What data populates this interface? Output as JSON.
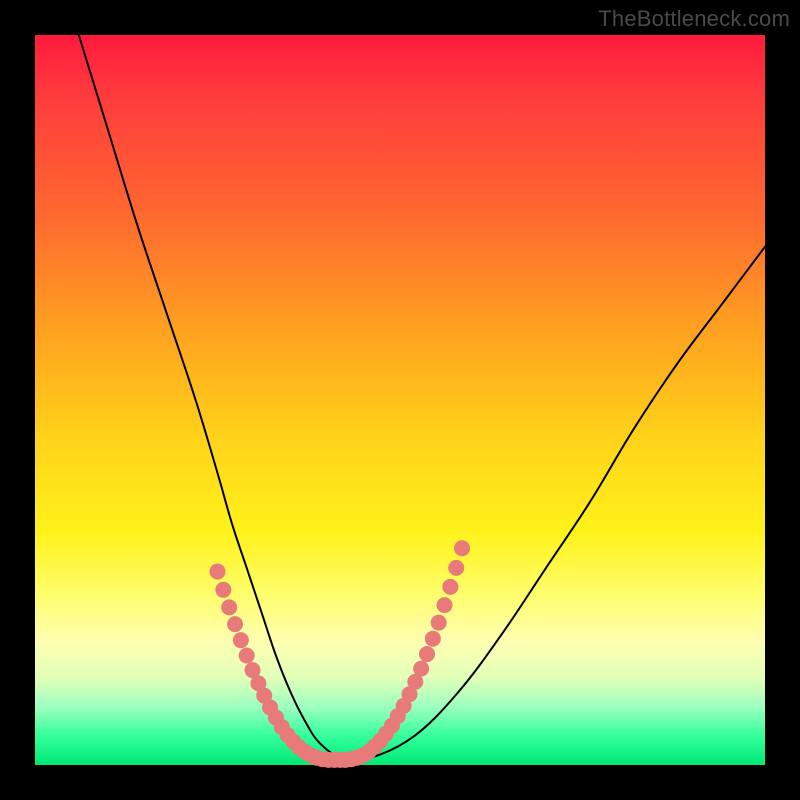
{
  "watermark": "TheBottleneck.com",
  "chart_data": {
    "type": "line",
    "title": "",
    "xlabel": "",
    "ylabel": "",
    "xlim": [
      0,
      100
    ],
    "ylim": [
      0,
      100
    ],
    "series": [
      {
        "name": "bottleneck-curve",
        "color": "#000000",
        "stroke_width": 2,
        "x": [
          6,
          10,
          14,
          18,
          22,
          25,
          27,
          29,
          31,
          33,
          35,
          37,
          39,
          42,
          46,
          52,
          58,
          64,
          70,
          76,
          82,
          88,
          94,
          100
        ],
        "values": [
          100,
          87,
          74,
          62,
          50,
          40,
          33,
          27,
          21,
          15,
          10,
          6,
          3,
          1,
          1,
          4,
          10,
          18,
          27,
          36,
          46,
          55,
          63,
          71
        ]
      },
      {
        "name": "bead-markers-left",
        "color": "#e87a7a",
        "marker": "circle",
        "marker_radius": 8,
        "x": [
          25.0,
          25.8,
          26.6,
          27.4,
          28.2,
          29.0,
          29.8,
          30.6,
          31.4,
          32.2,
          33.0,
          33.8,
          34.6,
          35.4,
          36.2,
          37.0,
          37.8,
          38.6,
          39.4,
          40.2,
          41.0,
          41.8
        ],
        "values": [
          26.5,
          24.0,
          21.6,
          19.3,
          17.1,
          15.0,
          13.0,
          11.2,
          9.5,
          7.9,
          6.5,
          5.2,
          4.1,
          3.2,
          2.4,
          1.8,
          1.3,
          1.0,
          0.8,
          0.7,
          0.7,
          0.7
        ]
      },
      {
        "name": "bead-markers-right",
        "color": "#e87a7a",
        "marker": "circle",
        "marker_radius": 8,
        "x": [
          42.5,
          43.3,
          44.1,
          44.9,
          45.7,
          46.5,
          47.3,
          48.1,
          48.9,
          49.7,
          50.5,
          51.3,
          52.1,
          52.9,
          53.7,
          54.5,
          55.3,
          56.1,
          56.9,
          57.7,
          58.5
        ],
        "values": [
          0.7,
          0.8,
          1.0,
          1.3,
          1.8,
          2.5,
          3.3,
          4.3,
          5.4,
          6.7,
          8.1,
          9.7,
          11.4,
          13.2,
          15.2,
          17.3,
          19.5,
          21.9,
          24.4,
          27.0,
          29.7
        ]
      }
    ]
  }
}
